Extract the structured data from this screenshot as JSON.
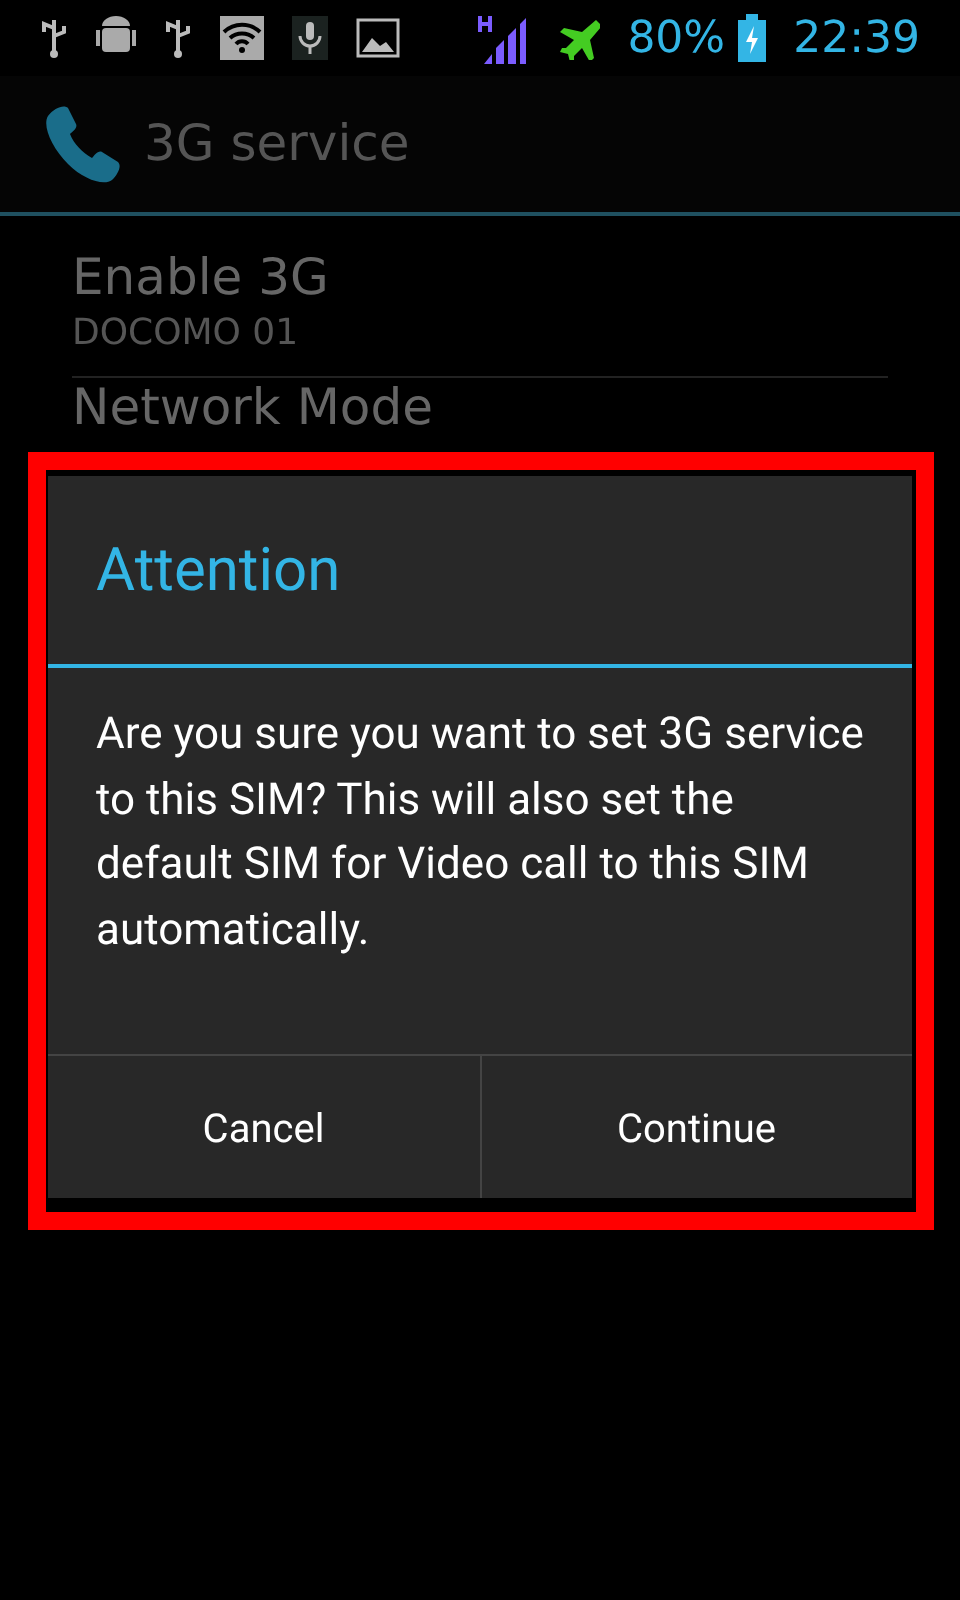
{
  "status_bar": {
    "battery": "80%",
    "time": "22:39"
  },
  "action_bar": {
    "title": "3G service"
  },
  "settings": [
    {
      "title": "Enable 3G",
      "summary": "DOCOMO 01"
    },
    {
      "title": "Network Mode"
    }
  ],
  "dialog": {
    "title": "Attention",
    "message": "Are you sure you want to set 3G service to this SIM? This will also set the default SIM for Video call to this SIM automatically.",
    "buttons": [
      "Cancel",
      "Continue"
    ]
  },
  "highlight": {
    "on": true
  }
}
